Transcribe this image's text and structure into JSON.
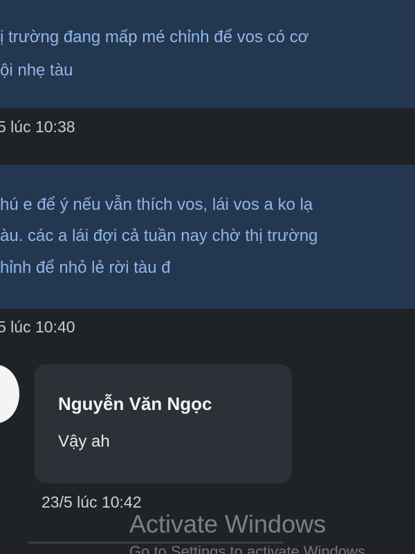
{
  "messages": [
    {
      "lines": [
        "ị trường đang mấp mé chỉnh để vos có cơ",
        "ội nhẹ tàu"
      ],
      "timestamp": "5 lúc 10:38"
    },
    {
      "lines": [
        "hú e để ý nếu vẫn thích vos, lái vos a ko lạ",
        "àu. các a lái đợi cả tuần nay chờ thị trường",
        "hỉnh để nhỏ lẻ rời tàu đ"
      ],
      "timestamp": "5 lúc 10:40"
    }
  ],
  "incoming": {
    "sender": "Nguyễn Văn Ngọc",
    "text": "Vậy ah",
    "timestamp": "23/5 lúc 10:42"
  },
  "watermark": {
    "title": "Activate Windows",
    "subtitle": "Go to Settings to activate Windows."
  },
  "colors": {
    "background": "#1f2227",
    "outgoing_bubble": "#243750",
    "outgoing_text": "#8fb6ea",
    "incoming_bubble": "#2c3037"
  }
}
